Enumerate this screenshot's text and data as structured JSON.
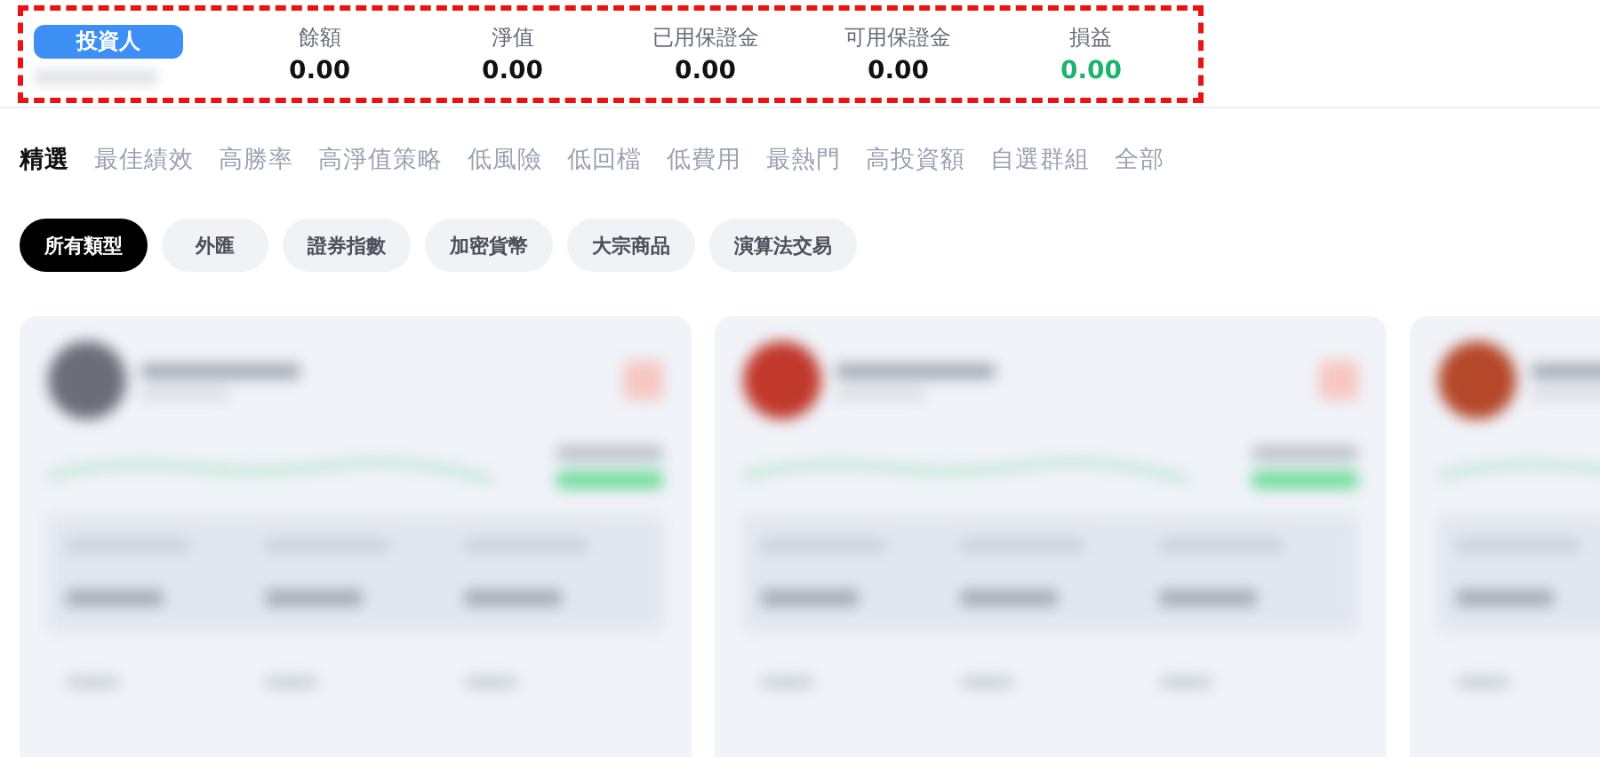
{
  "account": {
    "badge": "投資人",
    "stats": [
      {
        "label": "餘額",
        "value": "0.00",
        "color": "#111111"
      },
      {
        "label": "淨值",
        "value": "0.00",
        "color": "#111111"
      },
      {
        "label": "已用保證金",
        "value": "0.00",
        "color": "#111111"
      },
      {
        "label": "可用保證金",
        "value": "0.00",
        "color": "#111111"
      },
      {
        "label": "損益",
        "value": "0.00",
        "color": "#1db36a"
      }
    ]
  },
  "tabs": [
    {
      "label": "精選",
      "selected": true
    },
    {
      "label": "最佳績效",
      "selected": false
    },
    {
      "label": "高勝率",
      "selected": false
    },
    {
      "label": "高淨值策略",
      "selected": false
    },
    {
      "label": "低風險",
      "selected": false
    },
    {
      "label": "低回檔",
      "selected": false
    },
    {
      "label": "低費用",
      "selected": false
    },
    {
      "label": "最熱門",
      "selected": false
    },
    {
      "label": "高投資額",
      "selected": false
    },
    {
      "label": "自選群組",
      "selected": false
    },
    {
      "label": "全部",
      "selected": false
    }
  ],
  "filters": [
    {
      "label": "所有類型",
      "selected": true
    },
    {
      "label": "外匯",
      "selected": false
    },
    {
      "label": "證券指數",
      "selected": false
    },
    {
      "label": "加密貨幣",
      "selected": false
    },
    {
      "label": "大宗商品",
      "selected": false
    },
    {
      "label": "演算法交易",
      "selected": false
    }
  ],
  "cards": [
    {
      "kind": "blurred",
      "color": "#6b6e78"
    },
    {
      "kind": "blurred",
      "color": "#c0392b"
    },
    {
      "kind": "blurred",
      "color": "#b5482a"
    }
  ]
}
